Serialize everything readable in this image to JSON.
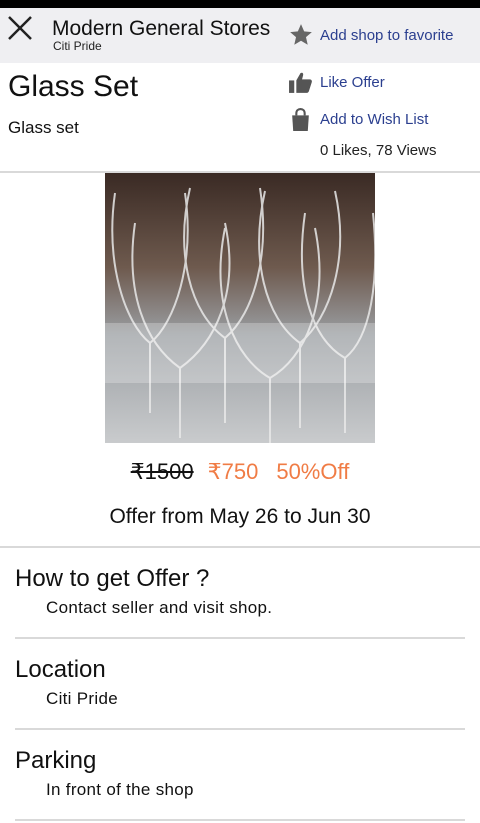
{
  "header": {
    "shop_name": "Modern General Stores",
    "shop_location": "Citi Pride",
    "favorite_label": "Add shop to favorite"
  },
  "product": {
    "title": "Glass Set",
    "subtitle": "Glass set",
    "like_label": "Like Offer",
    "wishlist_label": "Add to Wish List",
    "stats": "0 Likes, 78 Views",
    "old_price": "₹1500",
    "new_price": "₹750",
    "discount": "50%Off",
    "offer_dates": "Offer from May 26 to Jun 30"
  },
  "sections": [
    {
      "title": "How to get Offer ?",
      "text": "Contact seller and visit shop."
    },
    {
      "title": "Location",
      "text": "Citi Pride"
    },
    {
      "title": "Parking",
      "text": "In front of the shop"
    }
  ],
  "colors": {
    "link": "#2b3f8f",
    "accent": "#f07c45",
    "header_bg": "#efeff2"
  }
}
